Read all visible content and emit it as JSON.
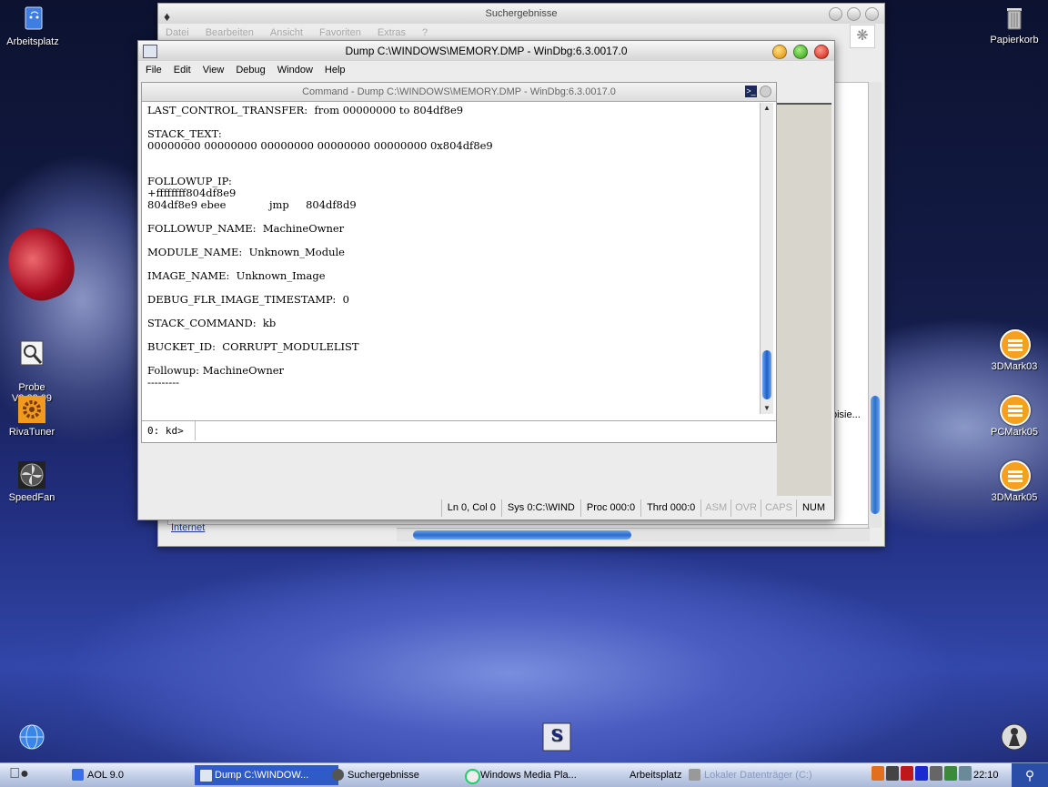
{
  "desktop": {
    "icons": [
      {
        "label": "Arbeitsplatz",
        "icon": "computer-icon"
      },
      {
        "label": "Papierkorb",
        "icon": "trash-icon"
      },
      {
        "label": "Probe\nV2.22.09",
        "icon": "probe-icon"
      },
      {
        "label": "RivaTuner",
        "icon": "gear-icon"
      },
      {
        "label": "SpeedFan",
        "icon": "fan-icon"
      },
      {
        "label": "3DMark03",
        "icon": "futuremark-icon"
      },
      {
        "label": "PCMark05",
        "icon": "futuremark-icon"
      },
      {
        "label": "3DMark05",
        "icon": "futuremark-icon"
      }
    ]
  },
  "explorer": {
    "title": "Suchergebnisse",
    "menu": [
      "Datei",
      "Bearbeiten",
      "Ansicht",
      "Favoriten",
      "Extras",
      "?"
    ],
    "internet_link": "Internet",
    "side_text": "bisie..."
  },
  "windbg": {
    "title": "Dump C:\\WINDOWS\\MEMORY.DMP - WinDbg:6.3.0017.0",
    "menu": [
      "File",
      "Edit",
      "View",
      "Debug",
      "Window",
      "Help"
    ],
    "command_window_title": "Command - Dump C:\\WINDOWS\\MEMORY.DMP - WinDbg:6.3.0017.0",
    "output_text": "LAST_CONTROL_TRANSFER:  from 00000000 to 804df8e9\n\nSTACK_TEXT:\n00000000 00000000 00000000 00000000 00000000 0x804df8e9\n\n\nFOLLOWUP_IP:\n+ffffffff804df8e9\n804df8e9 ebee             jmp     804df8d9\n\nFOLLOWUP_NAME:  MachineOwner\n\nMODULE_NAME:  Unknown_Module\n\nIMAGE_NAME:  Unknown_Image\n\nDEBUG_FLR_IMAGE_TIMESTAMP:  0\n\nSTACK_COMMAND:  kb\n\nBUCKET_ID:  CORRUPT_MODULELIST\n\nFollowup: MachineOwner\n---------",
    "prompt": "0: kd>",
    "status": {
      "position": "Ln 0, Col 0",
      "sys": "Sys 0:C:\\WIND",
      "proc": "Proc 000:0",
      "thrd": "Thrd 000:0",
      "asm": "ASM",
      "ovr": "OVR",
      "caps": "CAPS",
      "num": "NUM"
    }
  },
  "taskbar": {
    "buttons": [
      {
        "label": "AOL 9.0"
      },
      {
        "label": "Dump C:\\WINDOW..."
      },
      {
        "label": "Suchergebnisse"
      },
      {
        "label": "Windows Media Pla..."
      },
      {
        "label": "Arbeitsplatz"
      },
      {
        "label": "Lokaler Datenträger (C:)"
      }
    ],
    "clock": "22:10"
  }
}
